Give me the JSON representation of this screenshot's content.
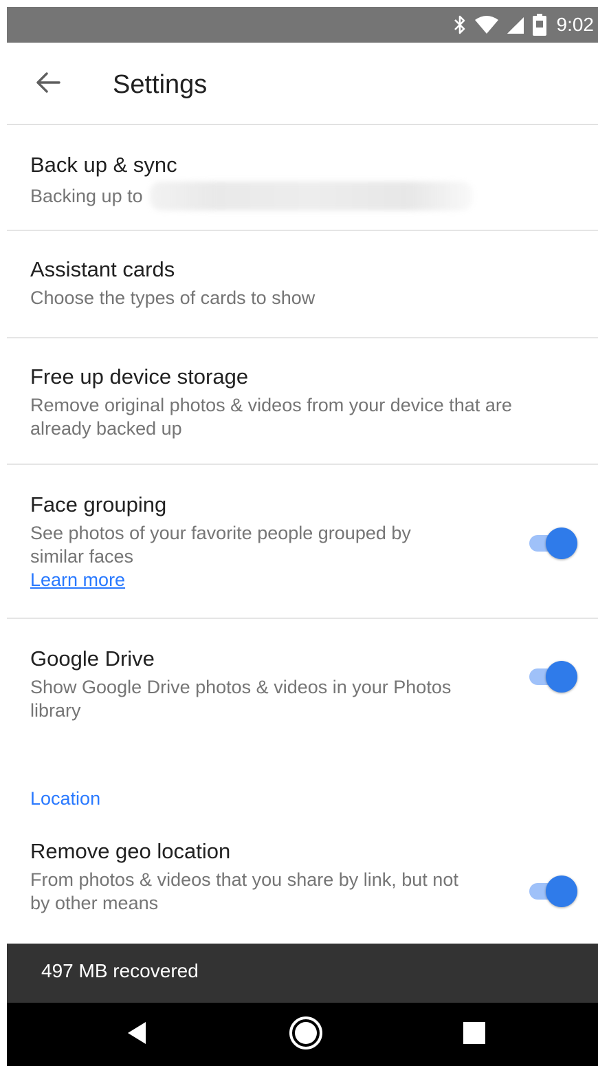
{
  "status_bar": {
    "time": "9:02",
    "icons": [
      "bluetooth-icon",
      "wifi-icon",
      "cell-signal-icon",
      "battery-icon"
    ]
  },
  "app_bar": {
    "title": "Settings",
    "back_icon": "arrow-back-icon"
  },
  "settings": {
    "backup": {
      "title": "Back up & sync",
      "description": "Backing up to"
    },
    "assistant": {
      "title": "Assistant cards",
      "description": "Choose the types of cards to show"
    },
    "storage": {
      "title": "Free up device storage",
      "description": "Remove original photos & videos from your device that are already backed up"
    },
    "face_grouping": {
      "title": "Face grouping",
      "description": "See photos of your favorite people grouped by similar faces",
      "link": "Learn more",
      "enabled": true
    },
    "google_drive": {
      "title": "Google Drive",
      "description": "Show Google Drive photos & videos in your Photos library",
      "enabled": true
    },
    "location_section": {
      "label": "Location"
    },
    "geo_location": {
      "title": "Remove geo location",
      "description": "From photos & videos that you share by link, but not by other means",
      "enabled": true
    }
  },
  "snackbar": {
    "message": "497 MB recovered"
  },
  "nav_bar": {
    "icons": [
      "back-triangle-icon",
      "home-circle-icon",
      "recents-square-icon"
    ]
  },
  "colors": {
    "accent": "#2979ff",
    "toggle_thumb": "#2f7bea",
    "toggle_track": "#9fc1f9",
    "status_bar": "#757575",
    "snackbar": "#333333"
  }
}
